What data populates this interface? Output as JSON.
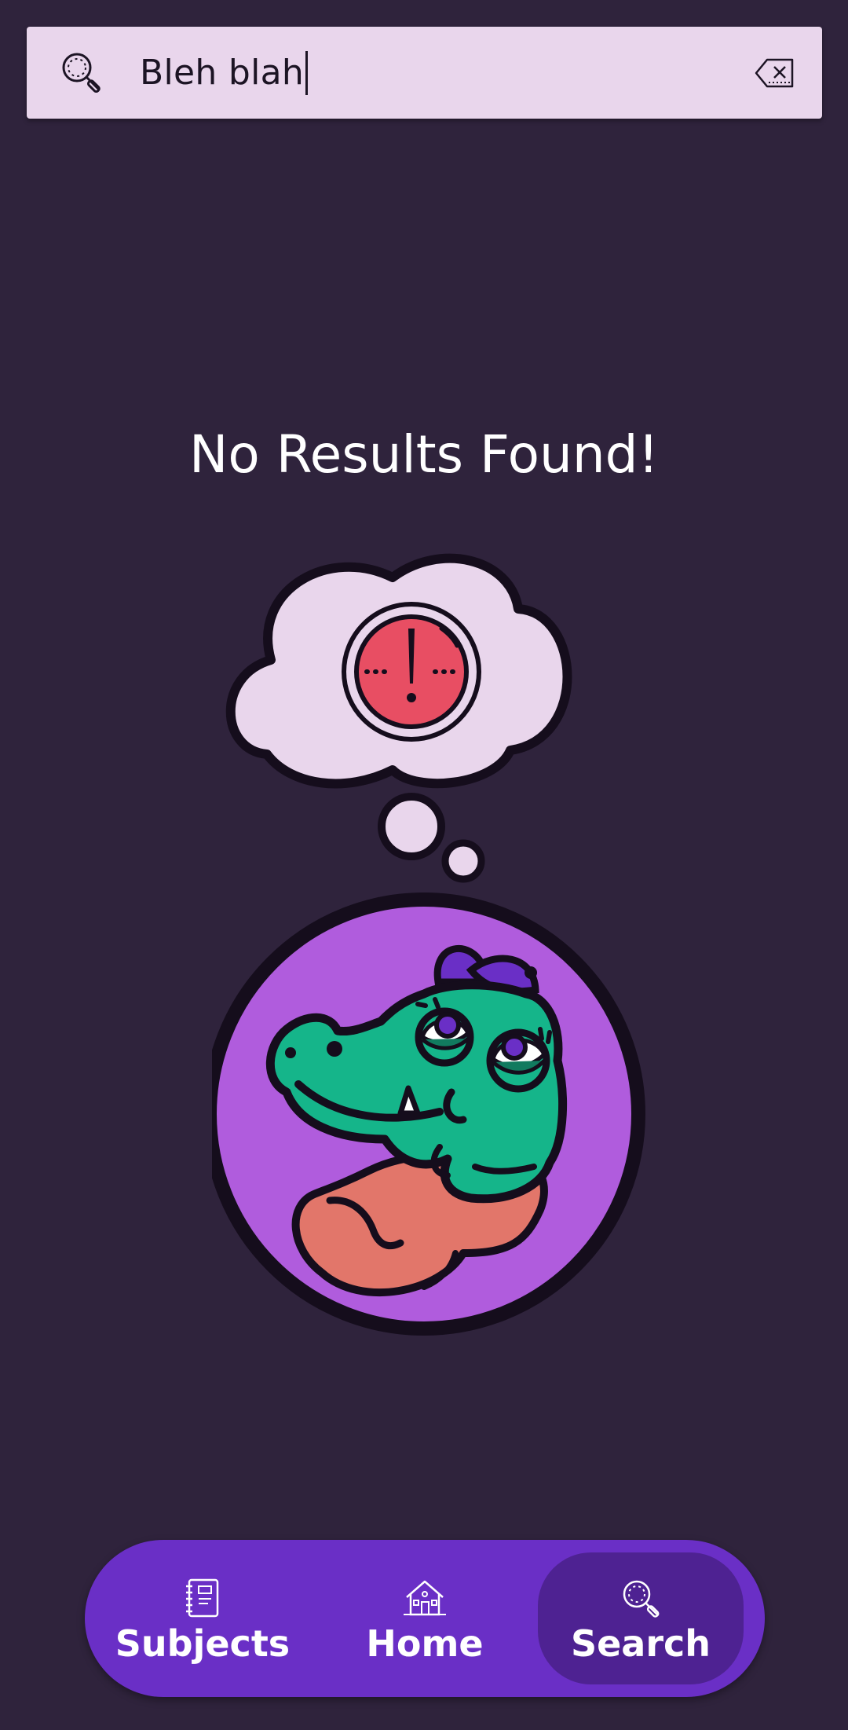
{
  "search": {
    "query": "Bleh blah",
    "search_icon": "search-icon",
    "clear_icon": "backspace-clear-icon"
  },
  "result": {
    "message": "No Results Found!",
    "illustration": "confused-crocodile-thought-bubble"
  },
  "nav": {
    "items": [
      {
        "label": "Subjects",
        "icon": "notebook-icon",
        "active": false
      },
      {
        "label": "Home",
        "icon": "house-icon",
        "active": false
      },
      {
        "label": "Search",
        "icon": "search-icon",
        "active": true
      }
    ]
  },
  "colors": {
    "background": "#2f233c",
    "search_bar": "#e9d6ec",
    "nav_bar": "#6a2fc6",
    "nav_active": "#4e2292",
    "alert_red": "#e84e63",
    "croc_green": "#15b58a",
    "circle_purple": "#b05cdd"
  }
}
